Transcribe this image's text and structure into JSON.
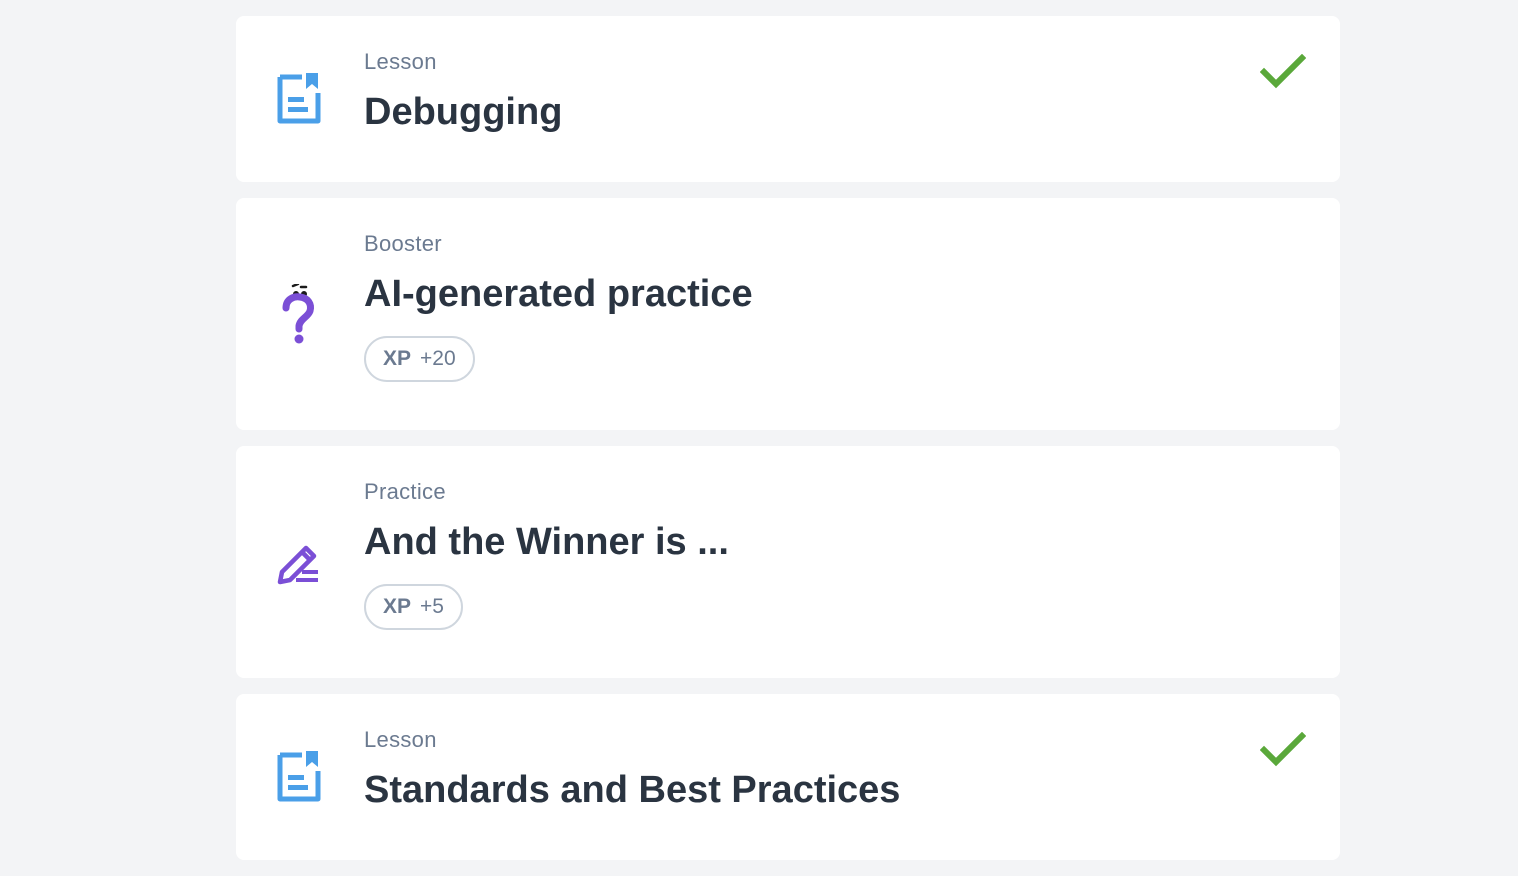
{
  "items": [
    {
      "type": "Lesson",
      "title": "Debugging",
      "icon": "lesson-doc-icon",
      "completed": true,
      "xp": null
    },
    {
      "type": "Booster",
      "title": "AI-generated practice",
      "icon": "question-mark-icon",
      "completed": false,
      "xp": {
        "label": "XP",
        "value": "+20"
      }
    },
    {
      "type": "Practice",
      "title": "And the Winner is ...",
      "icon": "pencil-edit-icon",
      "completed": false,
      "xp": {
        "label": "XP",
        "value": "+5"
      }
    },
    {
      "type": "Lesson",
      "title": "Standards and Best Practices",
      "icon": "lesson-doc-icon",
      "completed": true,
      "xp": null
    }
  ],
  "colors": {
    "background": "#f3f4f6",
    "lesson_icon": "#4a9fe8",
    "practice_icon": "#7b4fd6",
    "check": "#5aa83a",
    "title": "#2a3441",
    "muted": "#6b7a90"
  }
}
